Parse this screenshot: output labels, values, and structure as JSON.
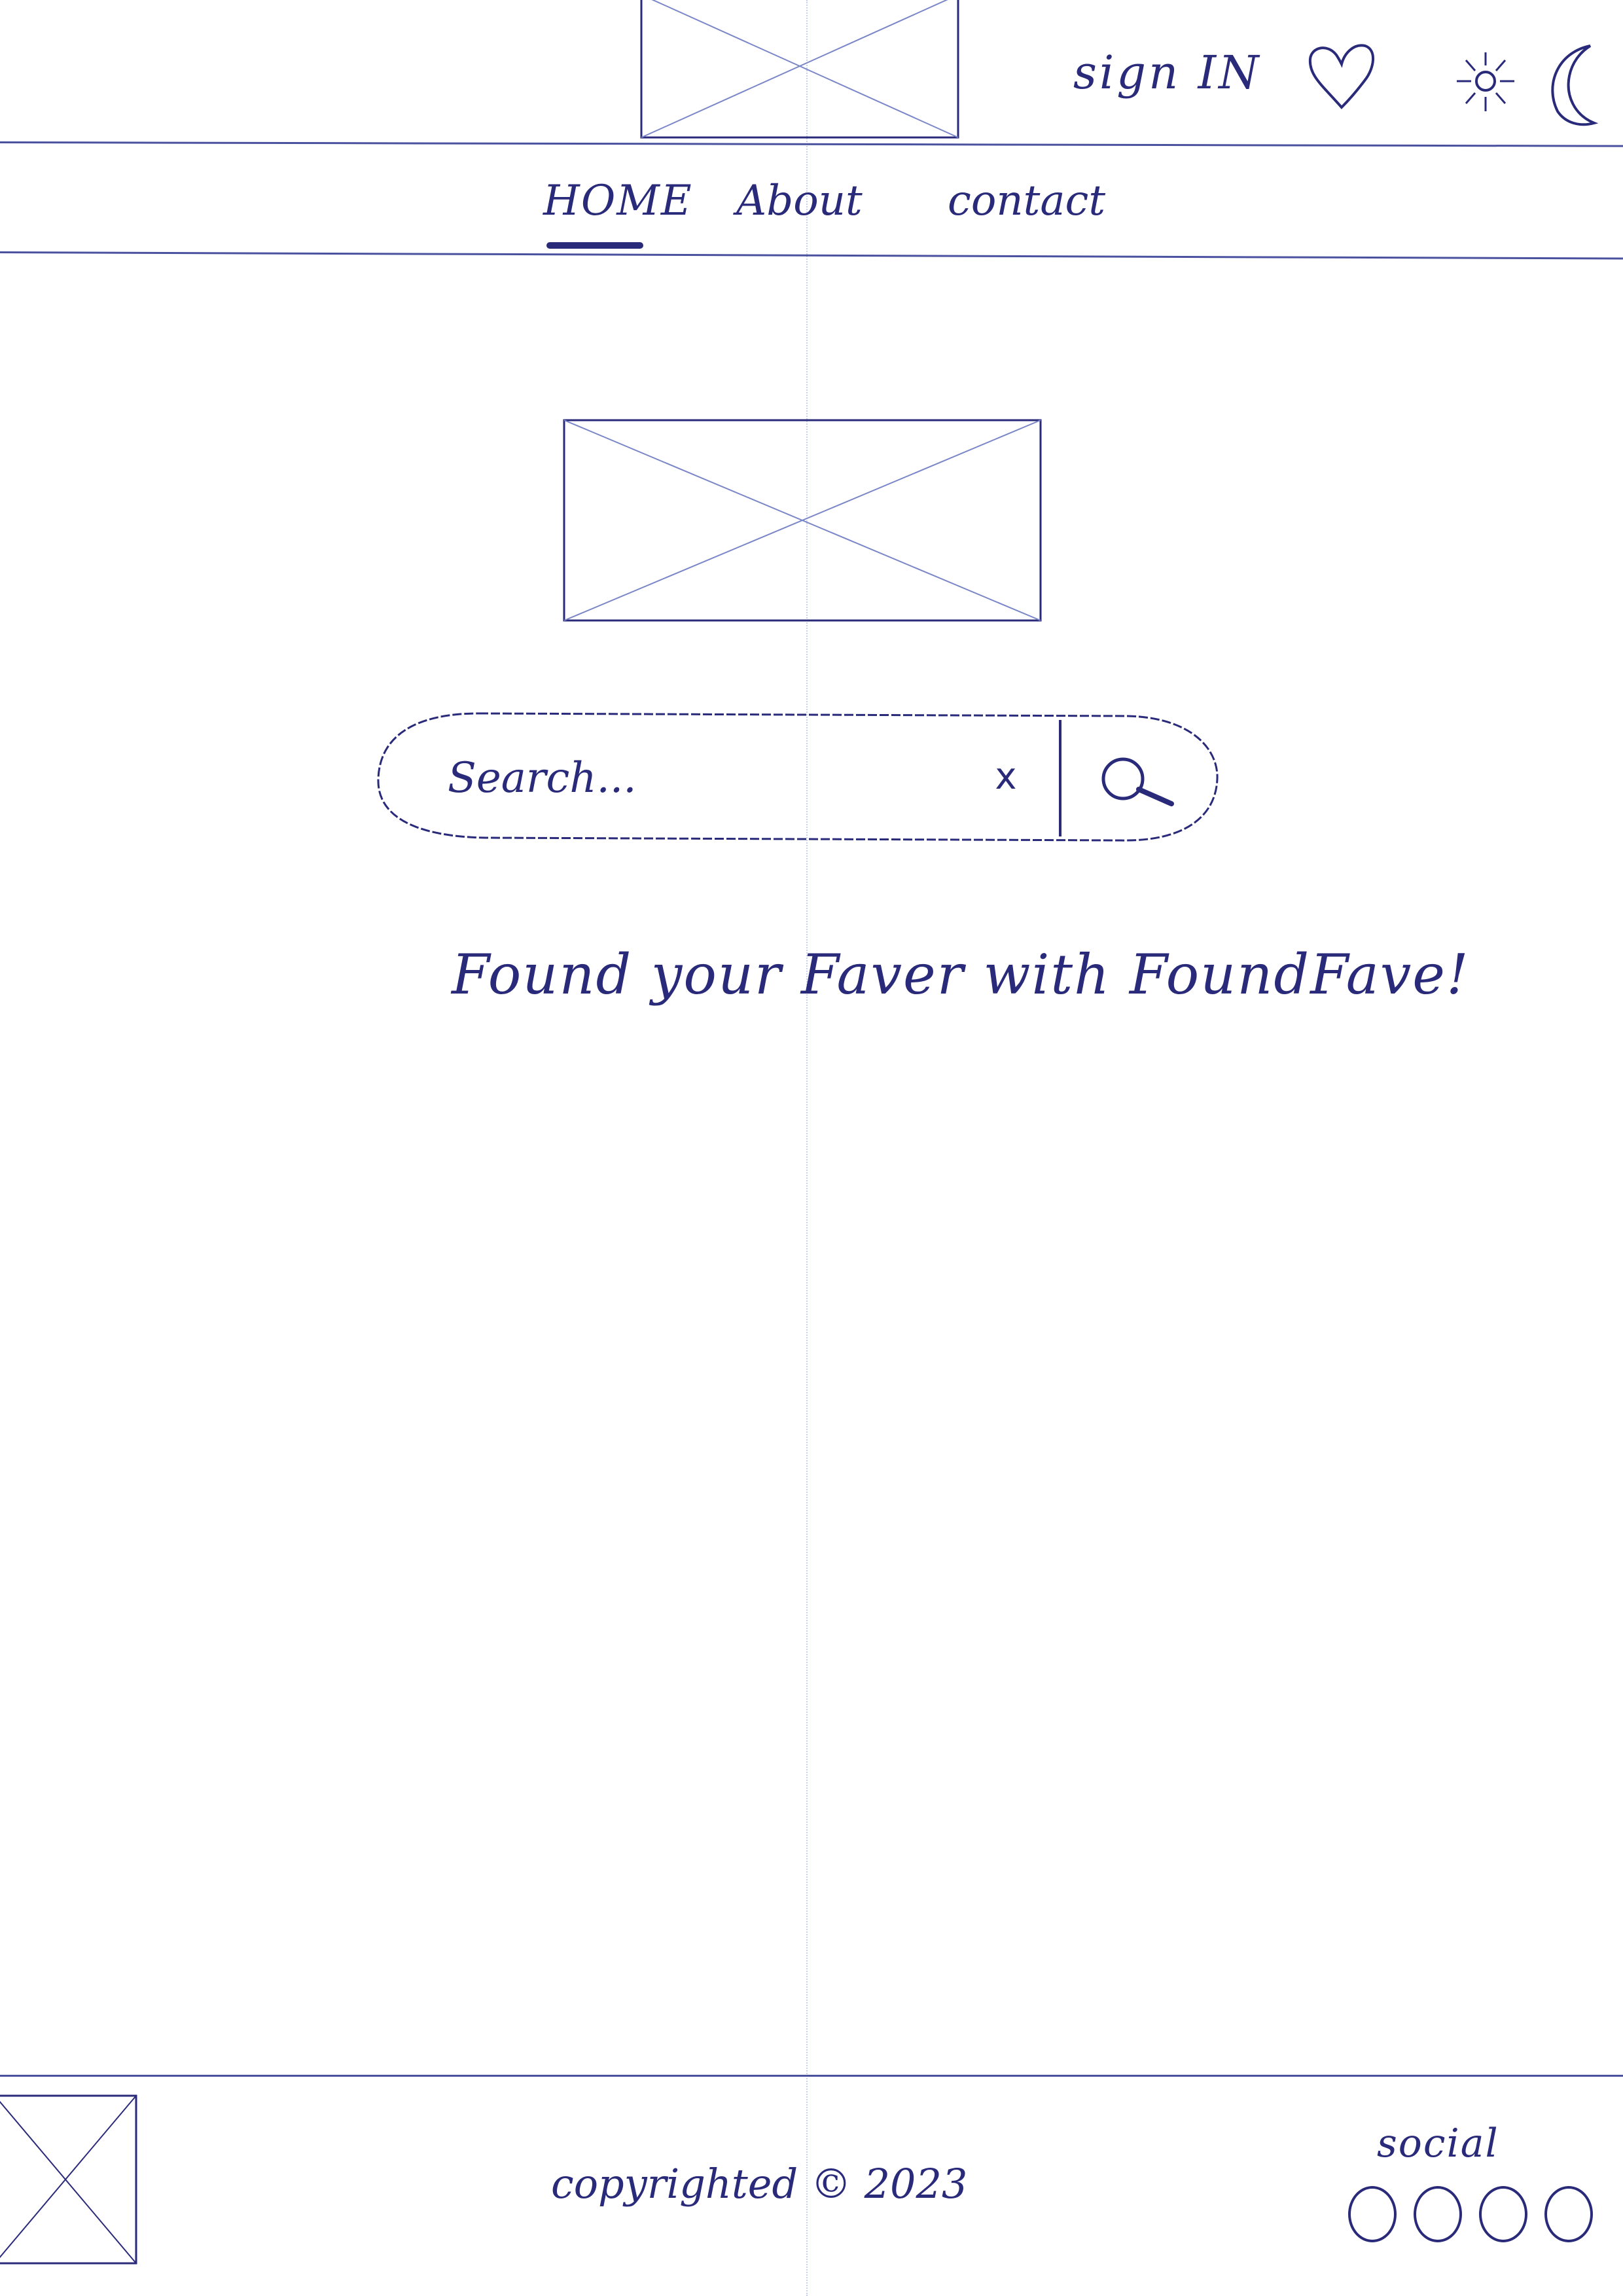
{
  "header": {
    "logo_icon": "image-placeholder-icon",
    "sign_in_label": "sign IN",
    "favorites_icon": "heart-icon",
    "light_mode_icon": "sun-icon",
    "dark_mode_icon": "moon-icon"
  },
  "nav": {
    "items": [
      {
        "label": "HOME",
        "active": true
      },
      {
        "label": "About",
        "active": false
      },
      {
        "label": "contact",
        "active": false
      }
    ]
  },
  "main": {
    "hero_icon": "image-placeholder-icon",
    "search": {
      "placeholder": "Search...",
      "clear_label": "x",
      "button_icon": "magnifier-icon"
    },
    "tagline": "Found your Faver with FoundFave!"
  },
  "footer": {
    "logo_icon": "image-placeholder-icon",
    "copyright": "copyrighted © 2023",
    "social_label": "social",
    "social_icon_count": 4
  },
  "colors": {
    "ink": "#2a2a7a",
    "rule": "#4a52a0",
    "guide": "#c9d0ee"
  }
}
